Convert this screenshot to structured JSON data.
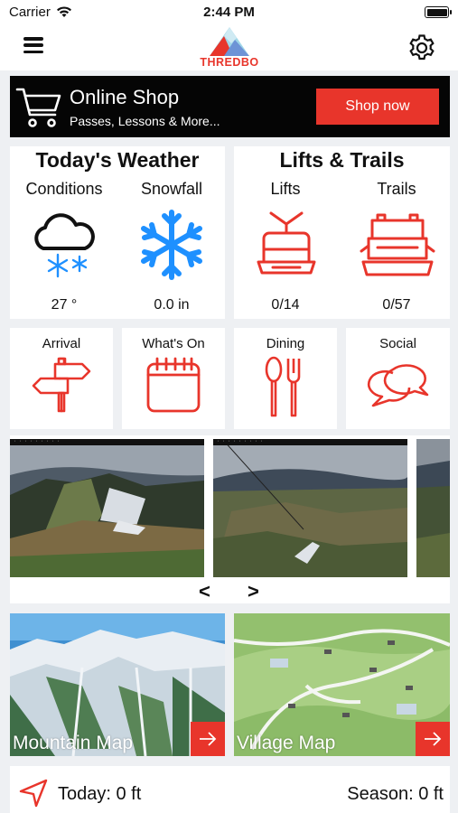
{
  "status_bar": {
    "carrier": "Carrier",
    "time": "2:44 PM"
  },
  "header": {
    "logo_text": "THREDBO",
    "menu_icon": "hamburger-menu-icon",
    "settings_icon": "gear-icon"
  },
  "shop": {
    "title": "Online Shop",
    "subtitle": "Passes, Lessons & More...",
    "button_label": "Shop now"
  },
  "weather": {
    "title": "Today's Weather",
    "conditions_label": "Conditions",
    "snowfall_label": "Snowfall",
    "temperature": "27 °",
    "snowfall": "0.0 in"
  },
  "lifts_trails": {
    "title": "Lifts & Trails",
    "lifts_label": "Lifts",
    "trails_label": "Trails",
    "lifts_value": "0/14",
    "trails_value": "0/57"
  },
  "tiles": [
    {
      "label": "Arrival",
      "icon": "signpost-icon"
    },
    {
      "label": "What's On",
      "icon": "calendar-icon"
    },
    {
      "label": "Dining",
      "icon": "cutlery-icon"
    },
    {
      "label": "Social",
      "icon": "chat-bubbles-icon"
    }
  ],
  "webcams": {
    "prev": "<",
    "next": ">"
  },
  "maps": {
    "mountain_label": "Mountain Map",
    "village_label": "Village Map"
  },
  "vertical": {
    "today": "Today: 0 ft",
    "season": "Season: 0 ft"
  },
  "colors": {
    "accent": "#e8352b",
    "weather_icon": "#1e90ff",
    "banner_bg": "#050505"
  }
}
